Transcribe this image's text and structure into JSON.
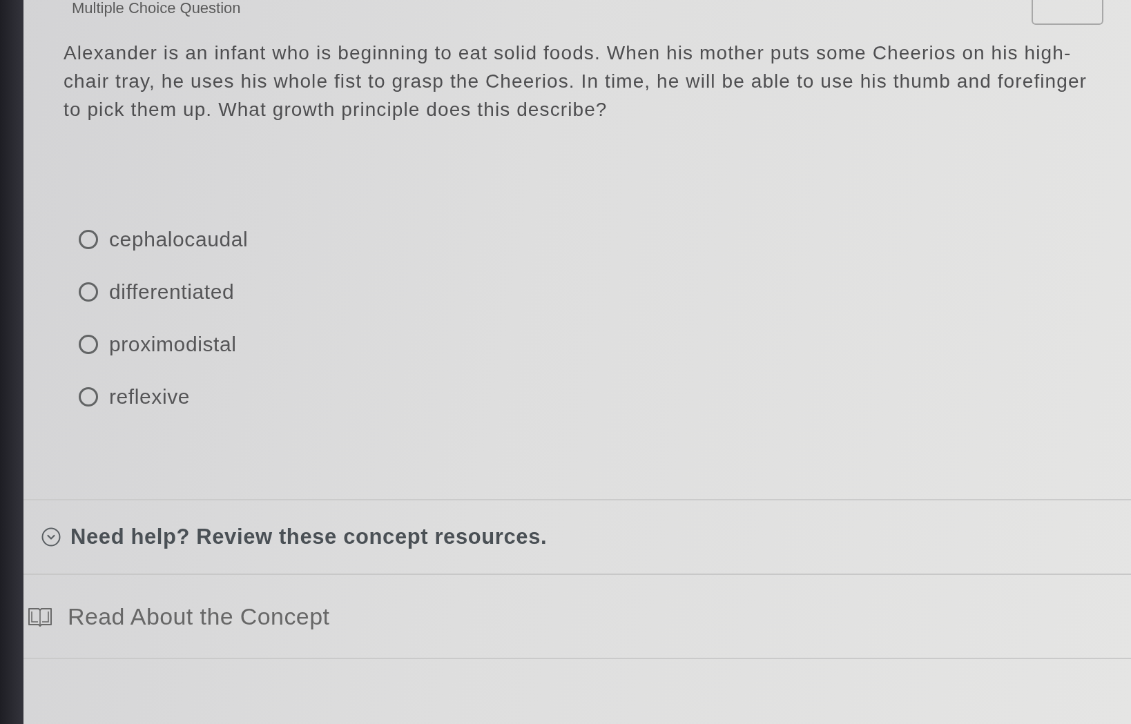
{
  "header": {
    "title": "Multiple Choice Question"
  },
  "question": "Alexander is an infant who is beginning to eat solid foods. When his mother puts some Cheerios on his high-chair tray, he uses his whole fist to grasp the Cheerios. In time, he will be able to use his thumb and forefinger to pick them up. What growth principle does this describe?",
  "options": [
    {
      "label": "cephalocaudal",
      "selected": false
    },
    {
      "label": "differentiated",
      "selected": false
    },
    {
      "label": "proximodistal",
      "selected": false
    },
    {
      "label": "reflexive",
      "selected": false
    }
  ],
  "help": {
    "label": "Need help? Review these concept resources.",
    "expanded": true,
    "resources": [
      {
        "label": "Read About the Concept"
      }
    ]
  }
}
